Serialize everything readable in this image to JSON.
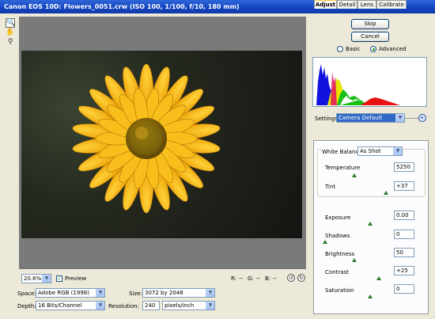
{
  "window": {
    "title": "Canon EOS 10D:  Flowers_0051.crw  (ISO 100, 1/100, f/10, 180 mm)"
  },
  "tools": [
    {
      "icon": "zoom-icon",
      "glyph": "🔍"
    },
    {
      "icon": "hand-icon",
      "glyph": "✋"
    },
    {
      "icon": "eyedropper-icon",
      "glyph": "⚲"
    }
  ],
  "actions": {
    "skip_label": "Skip",
    "cancel_label": "Cancel"
  },
  "mode": {
    "basic_label": "Basic",
    "advanced_label": "Advanced",
    "selected": "Advanced"
  },
  "settings": {
    "label": "Settings:",
    "value": "Camera Default"
  },
  "tabs": [
    {
      "label": "Adjust",
      "active": true
    },
    {
      "label": "Detail",
      "active": false
    },
    {
      "label": "Lens",
      "active": false
    },
    {
      "label": "Calibrate",
      "active": false
    }
  ],
  "white_balance": {
    "label": "White Balance:",
    "value": "As Shot"
  },
  "adjust": {
    "temperature": {
      "label": "Temperature",
      "value": "5250",
      "level": 0.33
    },
    "tint": {
      "label": "Tint",
      "value": "+37",
      "level": 0.68
    },
    "exposure": {
      "label": "Exposure",
      "value": "0.00",
      "level": 0.5
    },
    "shadows": {
      "label": "Shadows",
      "value": "0",
      "level": 0.0
    },
    "brightness": {
      "label": "Brightness",
      "value": "50",
      "level": 0.33
    },
    "contrast": {
      "label": "Contrast",
      "value": "+25",
      "level": 0.6
    },
    "saturation": {
      "label": "Saturation",
      "value": "0",
      "level": 0.5
    }
  },
  "preview": {
    "zoom": "20.6%",
    "label": "Preview",
    "checked": true
  },
  "readout": {
    "r": "R:",
    "g": "G:",
    "b": "B:",
    "r_val": "--",
    "g_val": "--",
    "b_val": "--"
  },
  "output": {
    "space_label": "Space:",
    "space_value": "Adobe RGB (1998)",
    "depth_label": "Depth:",
    "depth_value": "16 Bits/Channel",
    "size_label": "Size:",
    "size_value": "3072 by 2048",
    "resolution_label": "Resolution:",
    "resolution_value": "240",
    "resolution_unit": "pixels/inch"
  },
  "colors": {
    "title_bar": "#1446c2",
    "tab_highlight": "#ffc83c",
    "canvas_gray": "#7a7a7a",
    "petal": "#f2b10f"
  }
}
